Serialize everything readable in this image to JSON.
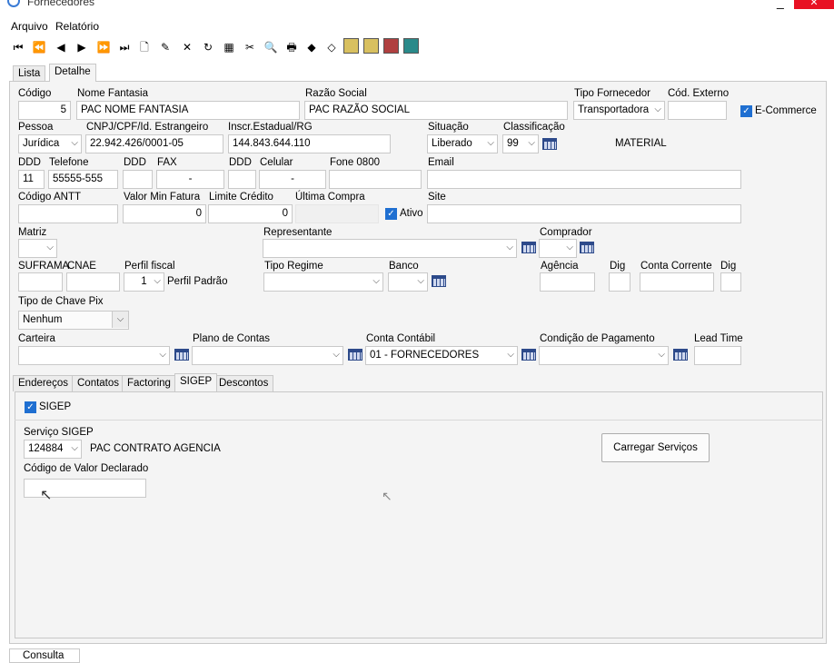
{
  "window": {
    "title": "Fornecedores",
    "minimize": "_",
    "close": "✕"
  },
  "menu": [
    "Arquivo",
    "Relatório"
  ],
  "toolbar": [
    "⏮",
    "⏪",
    "◀",
    "▶",
    "⏩",
    "⏭",
    "🗋",
    "✎",
    "✕",
    "↻",
    "▦",
    "✂",
    "🔍",
    "🖶",
    "◆",
    "◇",
    "▣",
    "▣",
    "▣",
    "▣"
  ],
  "tabs": {
    "lista": "Lista",
    "detalhe": "Detalhe"
  },
  "form": {
    "codigo_label": "Código",
    "codigo": "5",
    "nome_fantasia_label": "Nome Fantasia",
    "nome_fantasia": "PAC NOME FANTASIA",
    "razao_social_label": "Razão Social",
    "razao_social": "PAC RAZÃO SOCIAL",
    "tipo_fornecedor_label": "Tipo Fornecedor",
    "tipo_fornecedor": "Transportadora",
    "cod_externo_label": "Cód. Externo",
    "cod_externo": "",
    "ecommerce_label": "E-Commerce",
    "pessoa_label": "Pessoa",
    "pessoa": "Jurídica",
    "cnpj_label": "CNPJ/CPF/Id. Estrangeiro",
    "cnpj": "22.942.426/0001-05",
    "inscr_label": "Inscr.Estadual/RG",
    "inscr": "144.843.644.110",
    "situacao_label": "Situação",
    "situacao": "Liberado",
    "classificacao_label": "Classificação",
    "classificacao": "99",
    "material": "MATERIAL",
    "ddd_label": "DDD",
    "ddd": "11",
    "telefone_label": "Telefone",
    "telefone": "55555-555",
    "ddd2_label": "DDD",
    "fax_label": "FAX",
    "fax": "-",
    "ddd3_label": "DDD",
    "celular_label": "Celular",
    "celular": "-",
    "fone0800_label": "Fone 0800",
    "email_label": "Email",
    "antt_label": "Código ANTT",
    "valor_min_label": "Valor Min Fatura",
    "valor_min": "0",
    "limite_label": "Limite Crédito",
    "limite": "0",
    "ultima_compra_label": "Última Compra",
    "ativo_label": "Ativo",
    "site_label": "Site",
    "matriz_label": "Matriz",
    "representante_label": "Representante",
    "comprador_label": "Comprador",
    "suframa_label": "SUFRAMA",
    "cnae_label": "CNAE",
    "perfil_label": "Perfil fiscal",
    "perfil": "1",
    "perfil_desc": "Perfil Padrão",
    "tipo_regime_label": "Tipo Regime",
    "banco_label": "Banco",
    "agencia_label": "Agência",
    "dig_label": "Dig",
    "conta_label": "Conta Corrente",
    "dig2_label": "Dig",
    "pix_label": "Tipo de Chave Pix",
    "pix": "Nenhum",
    "carteira_label": "Carteira",
    "plano_label": "Plano de Contas",
    "conta_contabil_label": "Conta Contábil",
    "conta_contabil": "01 - FORNECEDORES",
    "condicao_label": "Condição de Pagamento",
    "lead_label": "Lead Time"
  },
  "subtabs": [
    "Endereços",
    "Contatos",
    "Factoring",
    "SIGEP",
    "Descontos"
  ],
  "sigep": {
    "check_label": "SIGEP",
    "servico_label": "Serviço SIGEP",
    "servico": "124884",
    "servico_desc": "PAC CONTRATO AGENCIA",
    "valor_decl_label": "Código de Valor Declarado",
    "carregar": "Carregar Serviços"
  },
  "bottom_tab": "Consulta",
  "check_mark": "✓",
  "chevron": "⌵",
  "cursor": "↖"
}
